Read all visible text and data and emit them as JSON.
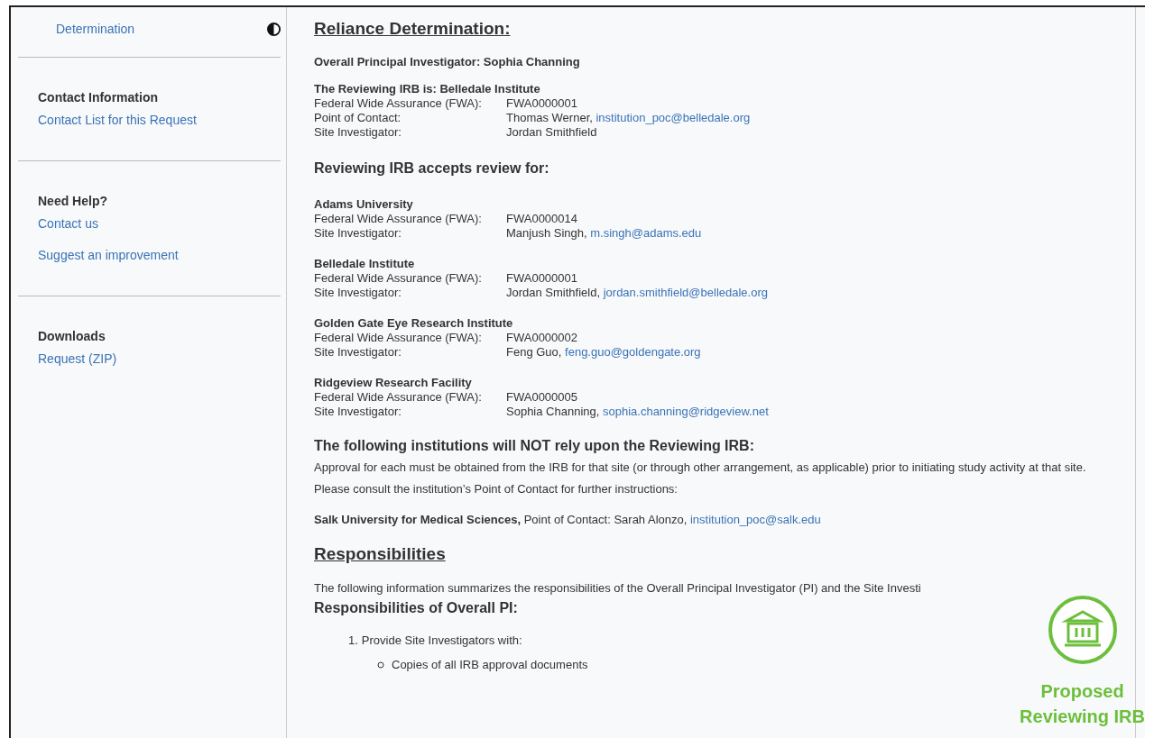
{
  "sidebar": {
    "top_link": "Determination",
    "sections": [
      {
        "heading": "Contact Information",
        "links": [
          "Contact List for this Request"
        ]
      },
      {
        "heading": "Need Help?",
        "links": [
          "Contact us",
          "Suggest an improvement"
        ]
      },
      {
        "heading": "Downloads",
        "links": [
          "Request (ZIP)"
        ]
      }
    ]
  },
  "main": {
    "title": "Reliance Determination:",
    "overall_pi": "Overall Principal Investigator: Sophia Channing",
    "reviewing_irb": {
      "heading": "The Reviewing IRB is: Belledale Institute",
      "fields": [
        {
          "label": "Federal Wide Assurance (FWA):",
          "value": "FWA0000001"
        },
        {
          "label": "Point of Contact:",
          "value": "Thomas Werner,",
          "email": "institution_poc@belledale.org"
        },
        {
          "label": "Site Investigator:",
          "value": "Jordan Smithfield"
        }
      ]
    },
    "accepts_heading": "Reviewing IRB accepts review for:",
    "institutions": [
      {
        "name": "Adams University",
        "fields": [
          {
            "label": "Federal Wide Assurance (FWA):",
            "value": "FWA0000014"
          },
          {
            "label": "Site Investigator:",
            "value": "Manjush Singh,",
            "email": "m.singh@adams.edu"
          }
        ]
      },
      {
        "name": "Belledale Institute",
        "fields": [
          {
            "label": "Federal Wide Assurance (FWA):",
            "value": "FWA0000001"
          },
          {
            "label": "Site Investigator:",
            "value": "Jordan Smithfield,",
            "email": "jordan.smithfield@belledale.org"
          }
        ]
      },
      {
        "name": "Golden Gate Eye Research Institute",
        "fields": [
          {
            "label": "Federal Wide Assurance (FWA):",
            "value": "FWA0000002"
          },
          {
            "label": "Site Investigator:",
            "value": "Feng Guo,",
            "email": "feng.guo@goldengate.org"
          }
        ]
      },
      {
        "name": "Ridgeview Research Facility",
        "fields": [
          {
            "label": "Federal Wide Assurance (FWA):",
            "value": "FWA0000005"
          },
          {
            "label": "Site Investigator:",
            "value": "Sophia Channing,",
            "email": "sophia.channing@ridgeview.net"
          }
        ]
      }
    ],
    "not_rely": {
      "heading": "The following institutions will NOT rely upon the Reviewing IRB:",
      "paragraph": "Approval for each must be obtained from the IRB for that site (or through other arrangement, as applicable) prior to initiating study activity at that site. Please consult the institution’s Point of Contact for further instructions:",
      "entries": [
        {
          "text": "**Salk University for Medical Sciences,** Point of Contact: Sarah Alonzo,",
          "email": "institution_poc@salk.edu"
        }
      ]
    },
    "responsibilities": {
      "title": "Responsibilities",
      "intro": "The following information summarizes the responsibilities of the Overall Principal Investigator (PI) and the Site Investi",
      "subheading": "Responsibilities of Overall PI:",
      "items": [
        {
          "number": "1.",
          "text": "Provide Site Investigators with:",
          "children": [
            {
              "text": "Copies of all IRB approval documents"
            }
          ]
        }
      ]
    }
  },
  "badge": {
    "lines": [
      "Proposed",
      "Reviewing IRB"
    ]
  }
}
